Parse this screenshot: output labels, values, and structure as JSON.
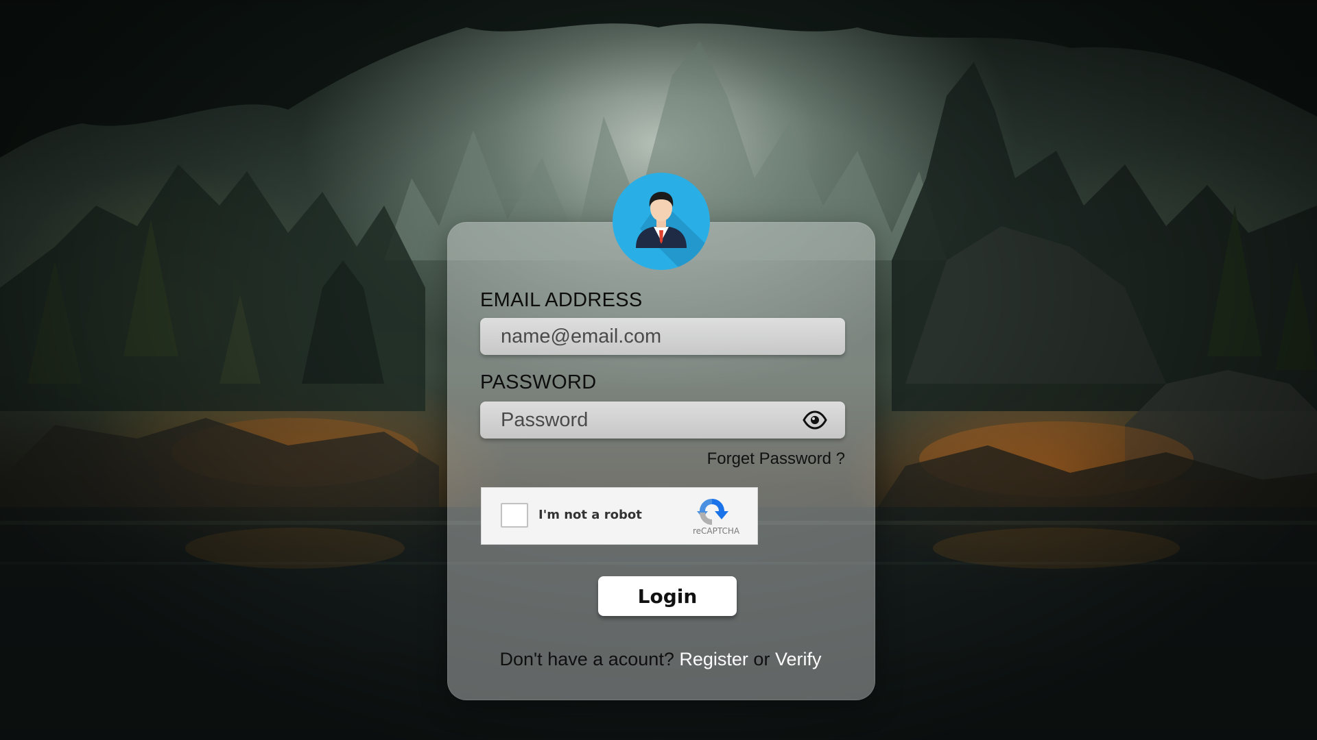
{
  "login_form": {
    "email_label": "EMAIL ADDRESS",
    "email_placeholder": "name@email.com",
    "email_value": "",
    "password_label": "PASSWORD",
    "password_placeholder": "Password",
    "password_value": "",
    "forget_password": "Forget Password ?",
    "captcha_text": "I'm not a robot",
    "captcha_brand": "reCAPTCHA",
    "captcha_checked": false,
    "login_button": "Login",
    "footer_prompt": "Don't have a acount?",
    "register_link": "Register",
    "or_text": "or",
    "verify_link": "Verify"
  },
  "icons": {
    "avatar": "user-avatar-icon",
    "password_toggle": "eye-icon",
    "captcha_logo": "recaptcha-logo-icon"
  },
  "colors": {
    "avatar_bg": "#29aee6",
    "link": "#fdfdfd",
    "button_bg": "#ffffff"
  }
}
